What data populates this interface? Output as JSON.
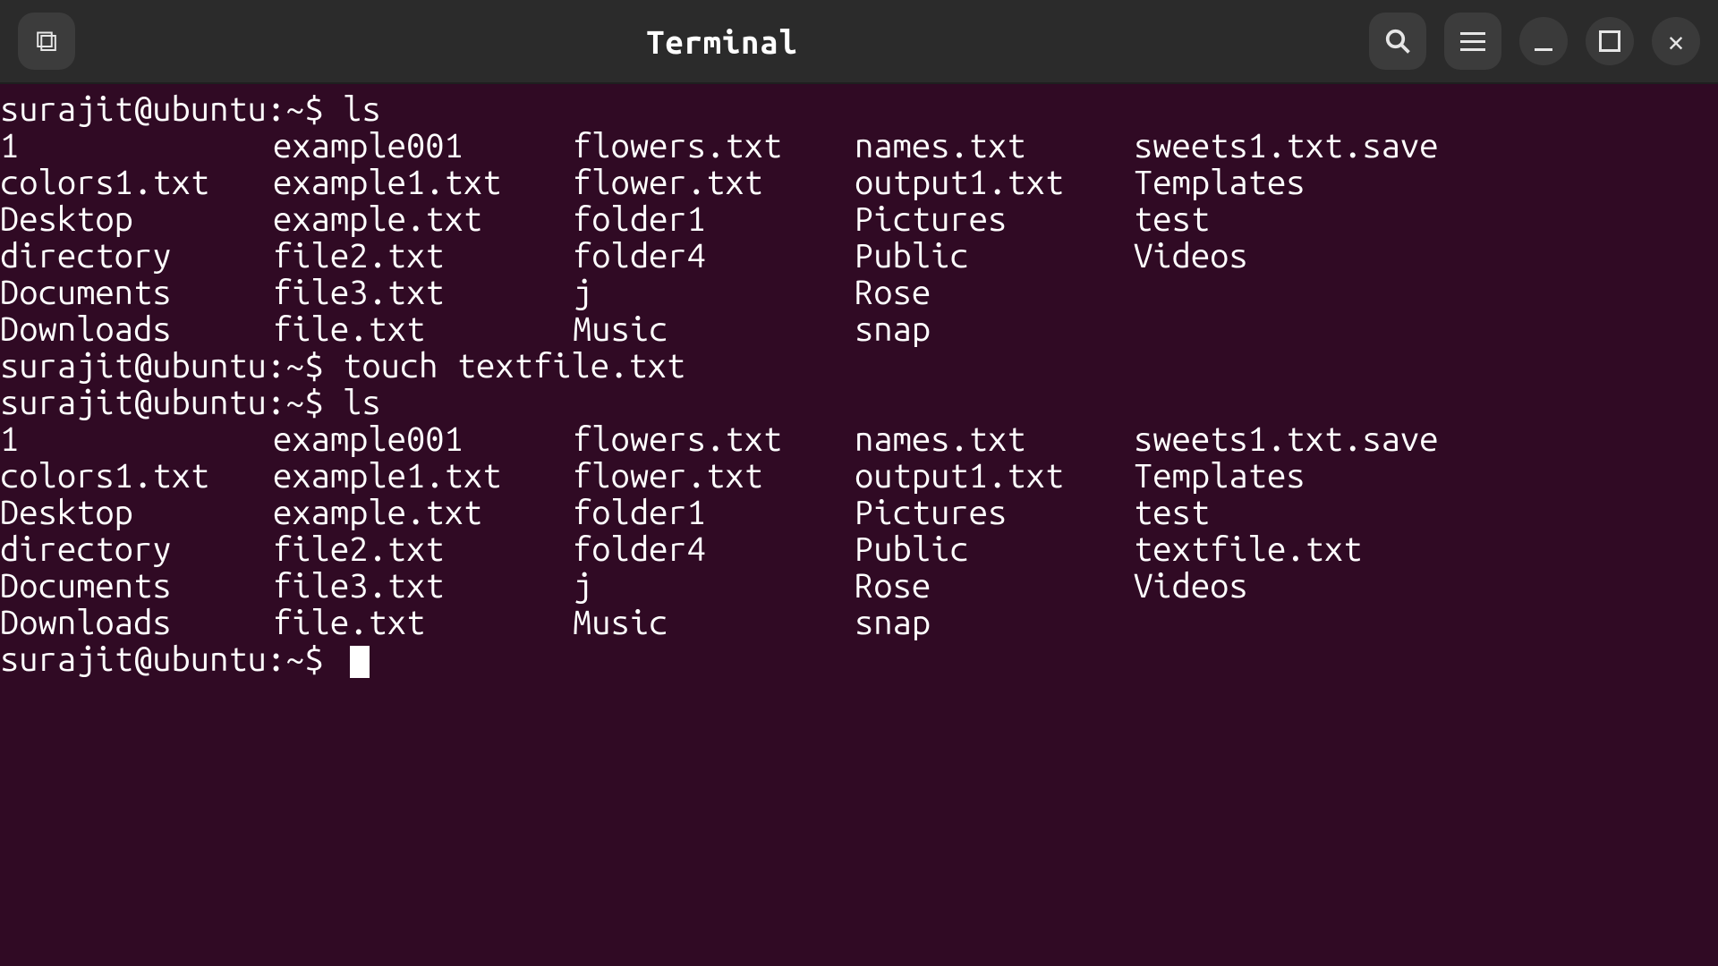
{
  "window": {
    "title": "Terminal"
  },
  "prompt": {
    "user": "surajit",
    "host": "ubuntu",
    "cwd": "~",
    "full": "surajit@ubuntu:~$"
  },
  "session": [
    {
      "type": "cmd",
      "command": "ls"
    },
    {
      "type": "ls",
      "columns": [
        [
          "1",
          "colors1.txt",
          "Desktop",
          "directory",
          "Documents",
          "Downloads"
        ],
        [
          "example001",
          "example1.txt",
          "example.txt",
          "file2.txt",
          "file3.txt",
          "file.txt"
        ],
        [
          "flowers.txt",
          "flower.txt",
          "folder1",
          "folder4",
          "j",
          "Music"
        ],
        [
          "names.txt",
          "output1.txt",
          "Pictures",
          "Public",
          "Rose",
          "snap"
        ],
        [
          "sweets1.txt.save",
          "Templates",
          "test",
          "Videos",
          "",
          ""
        ]
      ]
    },
    {
      "type": "cmd",
      "command": "touch textfile.txt"
    },
    {
      "type": "cmd",
      "command": "ls"
    },
    {
      "type": "ls",
      "columns": [
        [
          "1",
          "colors1.txt",
          "Desktop",
          "directory",
          "Documents",
          "Downloads"
        ],
        [
          "example001",
          "example1.txt",
          "example.txt",
          "file2.txt",
          "file3.txt",
          "file.txt"
        ],
        [
          "flowers.txt",
          "flower.txt",
          "folder1",
          "folder4",
          "j",
          "Music"
        ],
        [
          "names.txt",
          "output1.txt",
          "Pictures",
          "Public",
          "Rose",
          "snap"
        ],
        [
          "sweets1.txt.save",
          "Templates",
          "test",
          "textfile.txt",
          "Videos",
          ""
        ]
      ]
    },
    {
      "type": "prompt-only"
    }
  ]
}
